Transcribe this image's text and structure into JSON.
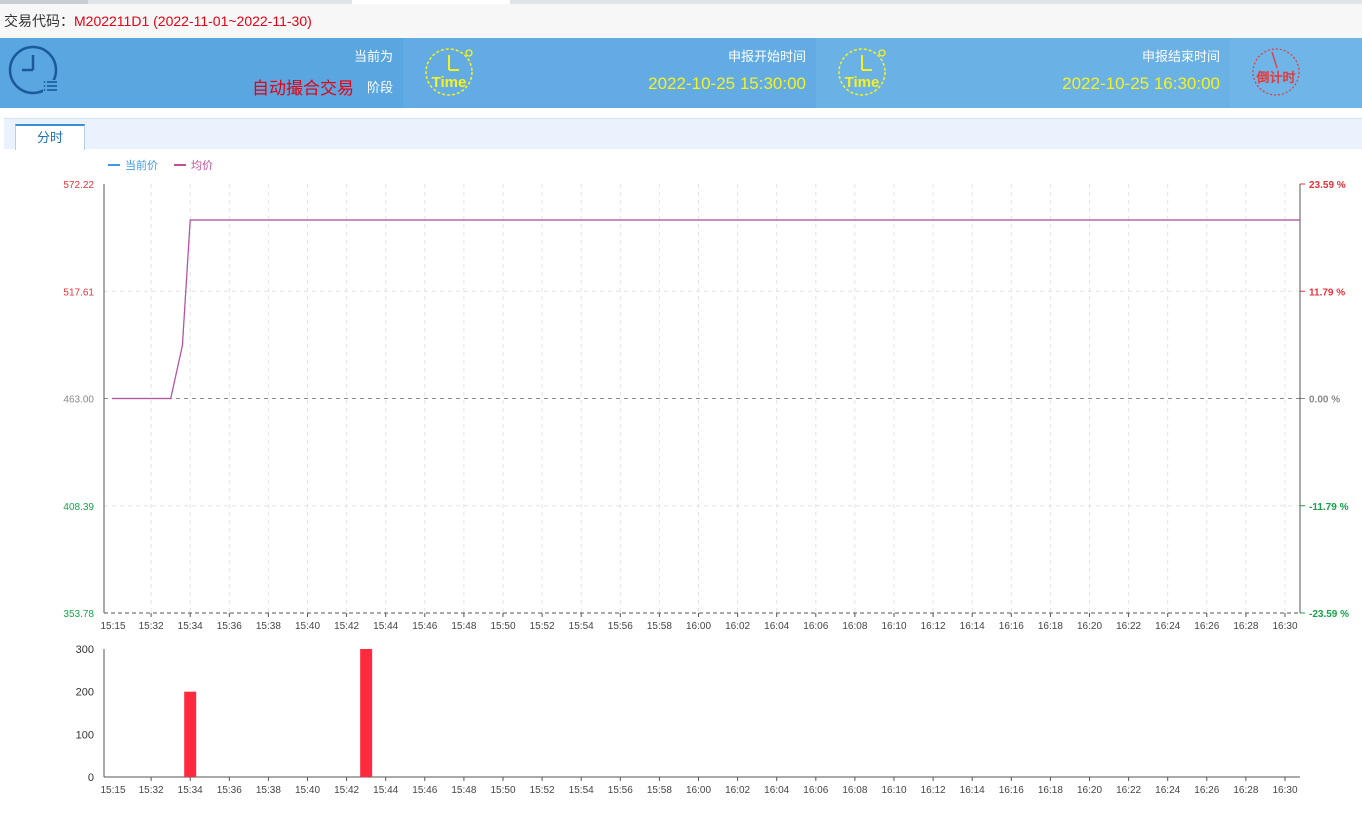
{
  "header": {
    "code_label": "交易代码：",
    "code_value": "M202211D1 (2022-11-01~2022-11-30)"
  },
  "banner": {
    "phase_label": "当前为",
    "phase_value": "自动撮合交易",
    "phase_suffix": "阶段",
    "clock_text": "Time",
    "start_label": "申报开始时间",
    "start_value": "2022-10-25 15:30:00",
    "end_label": "申报结束时间",
    "end_value": "2022-10-25 16:30:00",
    "countdown_text": "倒计时",
    "colors": {
      "accent_yellow": "#f7f21e",
      "phase_red": "#e60012",
      "countdown_red": "#e23b3b"
    }
  },
  "tabs": [
    {
      "label": "分时"
    }
  ],
  "chart_data": [
    {
      "type": "line",
      "legend": [
        "当前价",
        "均价"
      ],
      "legend_placement": "top-left",
      "x": [
        "15:15",
        "15:32",
        "15:34",
        "15:36",
        "15:38",
        "15:40",
        "15:42",
        "15:44",
        "15:46",
        "15:48",
        "15:50",
        "15:52",
        "15:54",
        "15:56",
        "15:58",
        "16:00",
        "16:02",
        "16:04",
        "16:06",
        "16:08",
        "16:10",
        "16:12",
        "16:14",
        "16:16",
        "16:18",
        "16:20",
        "16:22",
        "16:24",
        "16:26",
        "16:28",
        "16:30"
      ],
      "y_ticks": [
        "572.22",
        "517.61",
        "463.00",
        "408.39",
        "353.78"
      ],
      "ylim": [
        353.78,
        572.22
      ],
      "y2_ticks": [
        "23.59 %",
        "11.79 %",
        "0.00 %",
        "-11.79 %",
        "-23.59 %"
      ],
      "baseline": 463.0,
      "series": [
        {
          "name": "当前价",
          "points": [
            [
              0,
              463.0
            ],
            [
              1.5,
              463.0
            ],
            [
              1.8,
              490
            ],
            [
              2.0,
              553.9
            ],
            [
              30.4,
              553.9
            ]
          ]
        },
        {
          "name": "均价",
          "points": [
            [
              0,
              463.0
            ],
            [
              1.5,
              463.0
            ],
            [
              1.8,
              490
            ],
            [
              2.0,
              553.9
            ],
            [
              30.4,
              553.9
            ]
          ]
        }
      ],
      "colors": {
        "line1": "#3d9be6",
        "line2": "#c0509c",
        "up": "#e8313a",
        "down": "#16a34a",
        "neutral": "#888888"
      }
    },
    {
      "type": "bar",
      "x": [
        "15:15",
        "15:32",
        "15:34",
        "15:36",
        "15:38",
        "15:40",
        "15:42",
        "15:44",
        "15:46",
        "15:48",
        "15:50",
        "15:52",
        "15:54",
        "15:56",
        "15:58",
        "16:00",
        "16:02",
        "16:04",
        "16:06",
        "16:08",
        "16:10",
        "16:12",
        "16:14",
        "16:16",
        "16:18",
        "16:20",
        "16:22",
        "16:24",
        "16:26",
        "16:28",
        "16:30"
      ],
      "y_ticks": [
        "300",
        "200",
        "100",
        "0"
      ],
      "ylim": [
        0,
        300
      ],
      "bars": [
        {
          "x": 2.0,
          "value": 200
        },
        {
          "x": 6.5,
          "value": 300
        }
      ],
      "bar_color": "#ff2a3d"
    }
  ]
}
